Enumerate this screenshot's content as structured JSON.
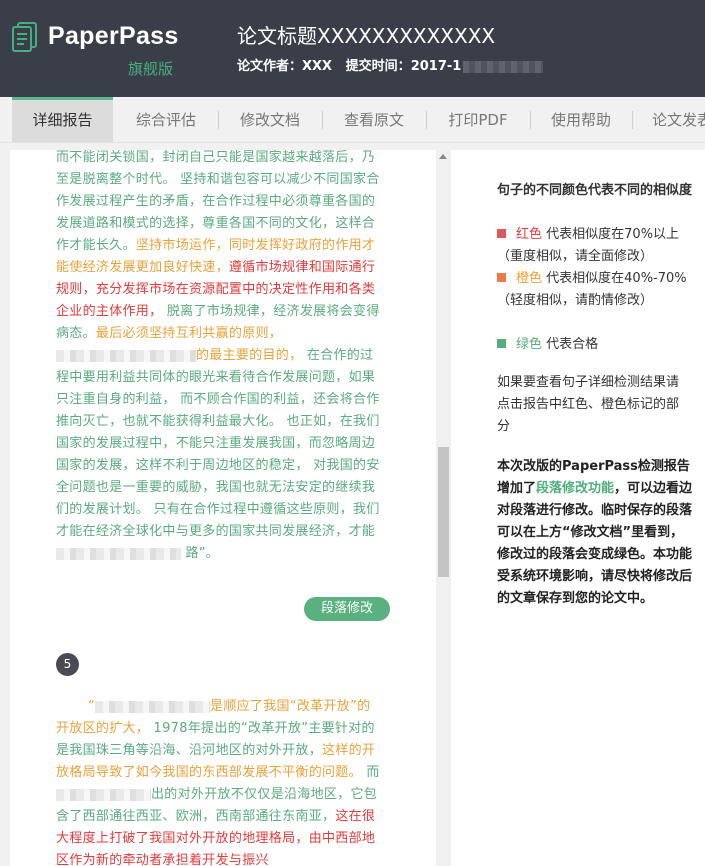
{
  "header": {
    "logo": "PaperPass",
    "edition": "旗舰版",
    "doc_title": "论文标题XXXXXXXXXXXXX",
    "author_label": "论文作者：",
    "author": "XXX",
    "submit_label": "提交时间：",
    "submit_time": "2017-1"
  },
  "tabs": [
    "详细报告",
    "综合评估",
    "修改文档",
    "查看原文",
    "打印PDF",
    "使用帮助",
    "论文发表"
  ],
  "paragraph4": {
    "s1": "而不能闭关锁国，封闭自己只能是国家越来越落后，乃至是脱离整个时代。 坚持和谐包容可以减少不同国家合作发展过程产生的矛盾，在合作过程中必须尊重各国的发展道路和模式的选择，尊重各国不同的文化，这样合作才能长久。",
    "s2": "坚持市场运作，同时发挥好政府的作用才能使经济发展更加良好快速，",
    "s3": "遵循市场规律和国际通行规则，充分发挥市场在资源配置中的决定性作用和各类企业的主体作用，",
    "s4": " 脱离了市场规律，经济发展将会变得病态。",
    "s5": "最后必须坚持互利共赢的原则，",
    "s6": "的最主要的目的，",
    "s7": " 在合作的过程中要用利益共同体的眼光来看待合作发展问题，如果只注重自身的利益， 而不顾合作国的利益，还会将合作推向灭亡，也就不能获得利益最大化。 也正如，在我们国家的发展过程中，不能只注重发展我国，而忽略周边国家的发展，这样不利于周边地区的稳定， 对我国的安全问题也是一重要的威胁，我国也就无法安定的继续我们的发展计划。 只有在合作过程中遵循这些原则，我们才能在经济全球化中与更多的国家共同发展经济，才能",
    "s8": "路”。",
    "button": "段落修改"
  },
  "paragraph5": {
    "number": "5",
    "s1": "“",
    "s2": "是顺应了我国“改革开放”的开放区的扩大，",
    "s3": " 1978年提出的“改革开放”主要针对的是我国珠三角等沿海、沿河地区的对外开放，",
    "s4": "这样的开放格局导致了如今我国的东西部发展不平衡的问题。",
    "s5": " 而",
    "s6": "出的对外开放不仅仅是沿海地区，它包含了西部通往西亚、欧洲，西南部通往东南亚，",
    "s7": "这在很大程度上打破了我国对外开放的地理格局，由中西部地区作为新的牵动者承担着开发与振兴"
  },
  "sidebar": {
    "title": "句子的不同颜色代表不同的相似度",
    "red_word": "红色",
    "red_desc": " 代表相似度在70%以上（重度相似，请全面修改）",
    "orange_word": "橙色",
    "orange_desc": " 代表相似度在40%-70%（轻度相似，请酌情修改）",
    "green_word": "绿色",
    "green_desc": " 代表合格",
    "note": "如果要查看句子详细检测结果请点击报告中红色、橙色标记的部分",
    "bold_1": "本次改版的PaperPass检测报告增加了",
    "bold_hl": "段落修改功能",
    "bold_2": "，可以边看边对段落进行修改。临时保存的段落可以在上方“修改文档”里看到，修改过的段落会变成绿色。本功能受系统环境影响，请尽快将修改后的文章保存到您的论文中。"
  },
  "colors": {
    "red": "#e23b3b",
    "orange": "#e8a23a",
    "green": "#5aab7f",
    "header_bg": "#3a3e49"
  }
}
